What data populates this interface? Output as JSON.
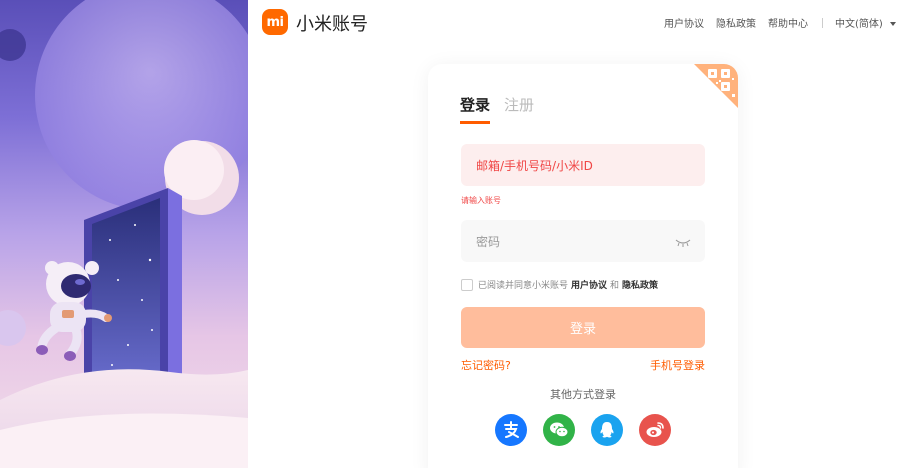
{
  "header": {
    "logo_mark": "mi",
    "title": "小米账号",
    "links": [
      "用户协议",
      "隐私政策",
      "帮助中心"
    ],
    "language": "中文(简体)"
  },
  "login": {
    "tabs": [
      {
        "label": "登录",
        "active": true
      },
      {
        "label": "注册",
        "active": false
      }
    ],
    "account_placeholder": "邮箱/手机号码/小米ID",
    "account_error": "请输入账号",
    "password_placeholder": "密码",
    "agreement": {
      "prefix": "已阅读并同意小米账号",
      "user_agreement": "用户协议",
      "and": "和",
      "privacy_policy": "隐私政策",
      "checked": false
    },
    "submit_label": "登录",
    "forgot_password": "忘记密码?",
    "phone_login": "手机号登录",
    "other_methods": "其他方式登录",
    "social_icons": [
      "alipay-icon",
      "wechat-icon",
      "qq-icon",
      "weibo-icon"
    ]
  },
  "colors": {
    "brand": "#ff6900",
    "accent": "#ff5c00",
    "error": "#f04645",
    "button_disabled": "#ffbd9c"
  }
}
